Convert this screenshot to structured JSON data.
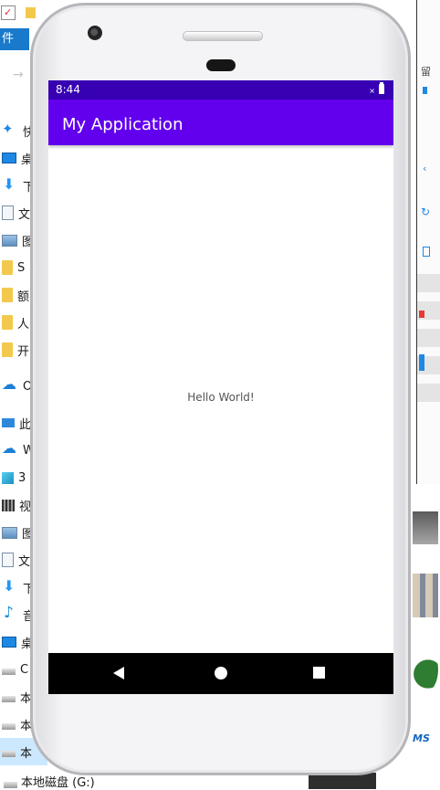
{
  "explorer": {
    "file_tab": "件",
    "nav_items": [
      {
        "icon": "quick-access-icon",
        "label": "快访"
      },
      {
        "icon": "desktop-icon",
        "label": "桌"
      },
      {
        "icon": "download-icon",
        "label": "下"
      },
      {
        "icon": "document-icon",
        "label": "文"
      },
      {
        "icon": "picture-icon",
        "label": "图"
      },
      {
        "icon": "folder-icon",
        "label": "S"
      },
      {
        "icon": "folder-icon",
        "label": "额"
      },
      {
        "icon": "folder-icon",
        "label": "人"
      },
      {
        "icon": "folder-icon",
        "label": "开"
      },
      {
        "icon": "onedrive-icon",
        "label": "On"
      },
      {
        "icon": "this-pc-icon",
        "label": "此电"
      },
      {
        "icon": "cloud-icon",
        "label": "W"
      },
      {
        "icon": "3d-objects-icon",
        "label": "3"
      },
      {
        "icon": "video-icon",
        "label": "视"
      },
      {
        "icon": "picture-icon",
        "label": "图"
      },
      {
        "icon": "document-icon",
        "label": "文"
      },
      {
        "icon": "download-icon",
        "label": "下"
      },
      {
        "icon": "music-icon",
        "label": "音"
      },
      {
        "icon": "desktop-icon",
        "label": "桌"
      },
      {
        "icon": "drive-icon",
        "label": "C"
      },
      {
        "icon": "drive-icon",
        "label": "本"
      },
      {
        "icon": "drive-icon",
        "label": "本"
      },
      {
        "icon": "drive-icon",
        "label": "本"
      }
    ],
    "bottom_drive_label": "本地磁盘 (G:)"
  },
  "emulator": {
    "status_time": "8:44",
    "status_signal": "×",
    "app_title": "My Application",
    "content_text": "Hello World!"
  }
}
